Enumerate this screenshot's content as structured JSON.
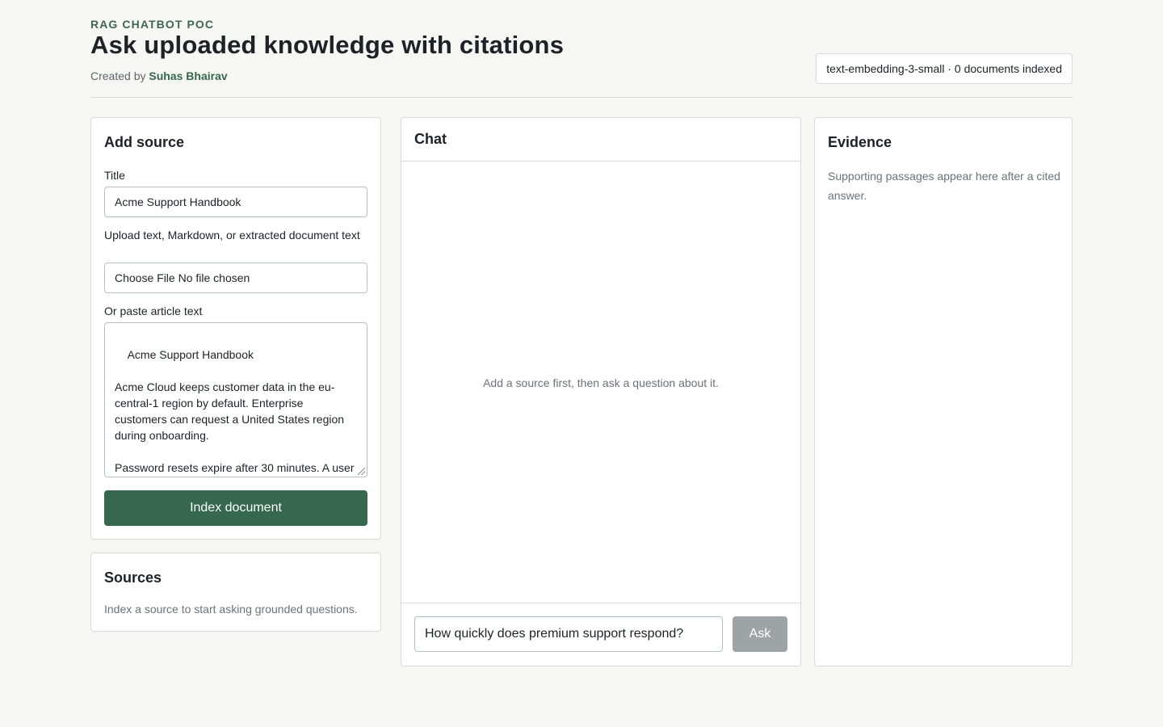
{
  "header": {
    "eyebrow": "RAG CHATBOT POC",
    "title": "Ask uploaded knowledge with citations",
    "byline_prefix": "Created by",
    "author": "Suhas Bhairav",
    "status": "text-embedding-3-small · 0 documents indexed"
  },
  "add_source": {
    "heading": "Add source",
    "title_label": "Title",
    "title_value": "Acme Support Handbook",
    "upload_label": "Upload text, Markdown, or extracted document text",
    "file_button": "Choose File",
    "file_status": "No file chosen",
    "paste_label": "Or paste article text",
    "paste_value": "Acme Support Handbook\n\nAcme Cloud keeps customer data in the eu-central-1 region by default. Enterprise customers can request a United States region during onboarding.\n\nPassword resets expire after 30 minutes. A user who misses that window must request a",
    "index_button": "Index document"
  },
  "sources": {
    "heading": "Sources",
    "empty": "Index a source to start asking grounded questions."
  },
  "chat": {
    "heading": "Chat",
    "empty": "Add a source first, then ask a question about it.",
    "input_value": "How quickly does premium support respond?",
    "ask_button": "Ask"
  },
  "evidence": {
    "heading": "Evidence",
    "empty": "Supporting passages appear here after a cited answer."
  },
  "colors": {
    "accent": "#35684f",
    "background": "#f6f7f2",
    "disabled_button": "#9ea3a6",
    "border": "#d9dcd6"
  }
}
